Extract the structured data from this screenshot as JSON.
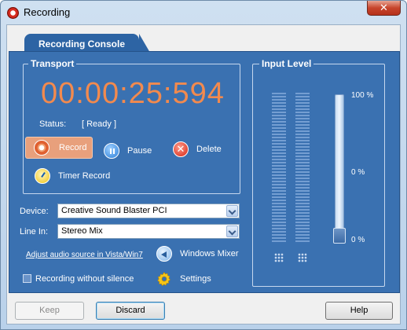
{
  "window": {
    "title": "Recording",
    "close_glyph": "✕"
  },
  "tab": {
    "label": "Recording Console"
  },
  "transport": {
    "title": "Transport",
    "timer": "00:00:25:594",
    "status_label": "Status:",
    "status_value": "[ Ready ]",
    "record_label": "Record",
    "pause_label": "Pause",
    "delete_label": "Delete",
    "timer_record_label": "Timer Record"
  },
  "device": {
    "label": "Device:",
    "value": "Creative Sound Blaster PCI"
  },
  "line_in": {
    "label": "Line In:",
    "value": "Stereo Mix"
  },
  "adjust_link": "Adjust audio source in Vista/Win7",
  "windows_mixer_label": "Windows Mixer",
  "recording_without_silence": {
    "label": "Recording without silence",
    "checked": true
  },
  "settings_label": "Settings",
  "input_level": {
    "title": "Input Level",
    "scale_top": "100 %",
    "scale_mid": "0 %",
    "scale_bottom": "0 %",
    "slider_level_percent": 0
  },
  "buttons": {
    "keep": "Keep",
    "discard": "Discard",
    "help": "Help"
  },
  "colors": {
    "accent": "#3a71b1",
    "timer": "#f28a4e",
    "record_button": "#e8a07c"
  },
  "icons": {
    "app": "record-icon",
    "record": "record-icon",
    "pause": "pause-icon",
    "delete": "delete-icon",
    "timer": "timer-icon",
    "mixer": "speaker-icon",
    "settings": "gear-icon"
  }
}
